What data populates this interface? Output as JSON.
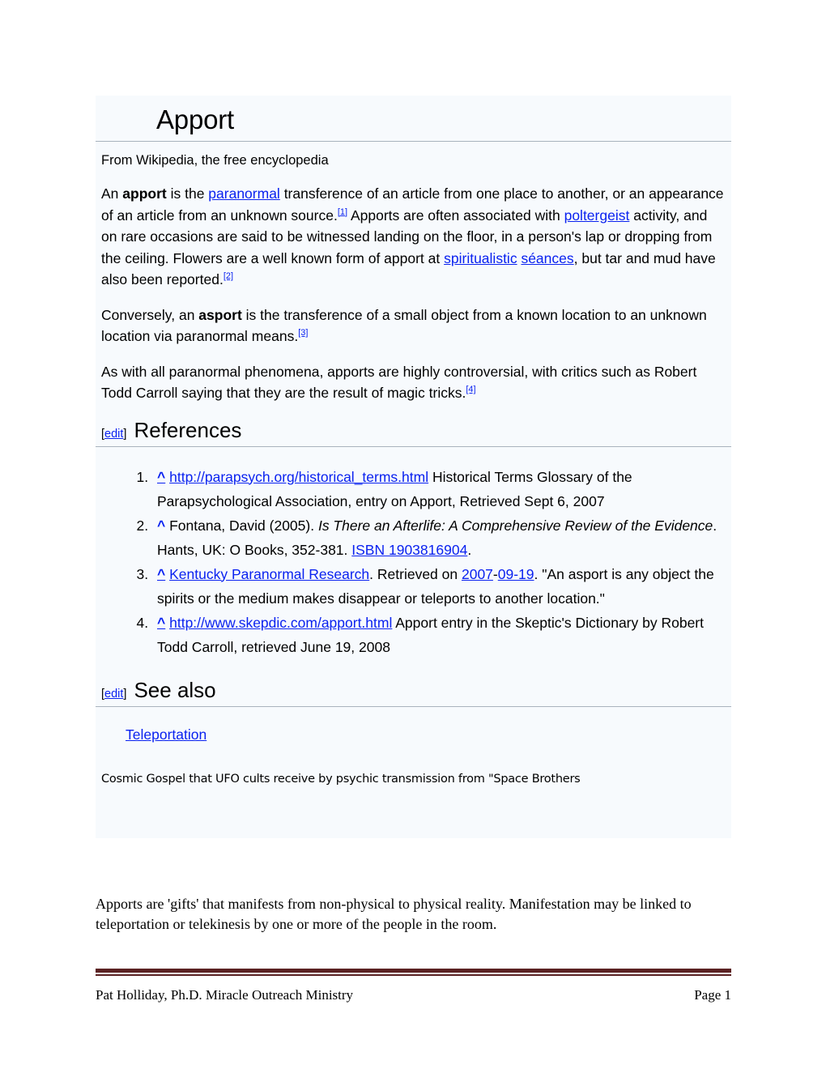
{
  "document": {
    "title": "Apport",
    "tagline": "From Wikipedia, the free encyclopedia"
  },
  "colors": {
    "link": "#0a22f0",
    "block_background": "#f7fafd",
    "page_background": "#ffffff",
    "rule": "#a9b3bd",
    "footer_rule": "#5b2223"
  },
  "intro": {
    "p1": {
      "s1": "An ",
      "bold1": "apport",
      "s2": " is the ",
      "link1": "paranormal",
      "s3": " transference of an article from one place to another, or an appearance of an article from an unknown source.",
      "ref1": "[1]",
      "s4": " Apports are often associated with ",
      "link2": "poltergeist",
      "s5": " activity, and on rare occasions are said to be witnessed landing on the floor, in a person's lap or dropping from the ceiling. Flowers are a well known form of apport at ",
      "link3": "spiritualistic",
      "s6": " ",
      "link4": "séances",
      "s7": ", but tar and mud have also been reported.",
      "ref2": "[2]"
    },
    "p2": {
      "s1": "Conversely, an ",
      "bold1": "asport",
      "s2": " is the transference of a small object from a known location to an unknown location via paranormal means.",
      "ref1": "[3]"
    },
    "p3": {
      "s1": "As with all paranormal phenomena, apports are highly controversial, with critics such as Robert Todd Carroll saying that they are the result of magic tricks.",
      "ref1": "[4]"
    }
  },
  "sections": {
    "references": {
      "edit_open": "[",
      "edit_label": "edit",
      "edit_close": "]",
      "title": "References",
      "items": [
        {
          "marker": "^",
          "link": "http://parapsych.org/historical_terms.html",
          "text": " Historical Terms Glossary of the Parapsychological Association, entry on Apport, Retrieved Sept 6, 2007"
        },
        {
          "marker": "^",
          "pre": " Fontana, David (2005). ",
          "italic": "Is There an Afterlife: A Comprehensive Review of the Evidence",
          "mid": ". Hants, UK: O Books, 352-381. ",
          "isbn": "ISBN 1903816904",
          "post": "."
        },
        {
          "marker": "^",
          "link": "Kentucky Paranormal Research",
          "mid": ". Retrieved on ",
          "date_year": "2007",
          "date_sep": "-",
          "date_rest": "09-19",
          "post": ". \"An asport is any object the spirits or the medium makes disappear or teleports to another location.\""
        },
        {
          "marker": "^",
          "link": "http://www.skepdic.com/apport.html",
          "text": " Apport entry in the Skeptic's Dictionary by Robert Todd Carroll, retrieved June 19, 2008"
        }
      ]
    },
    "see_also": {
      "edit_open": "[",
      "edit_label": "edit",
      "edit_close": "]",
      "title": "See also",
      "link": "Teleportation",
      "note": "Cosmic Gospel that UFO cults receive by psychic transmission from \"Space Brothers"
    }
  },
  "closing": {
    "text": "Apports are 'gifts' that manifests from non-physical to physical reality. Manifestation may be linked to teleportation or telekinesis by one or more of the people in the room."
  },
  "footer": {
    "left": "Pat Holliday, Ph.D. Miracle Outreach Ministry",
    "right": "Page 1"
  }
}
